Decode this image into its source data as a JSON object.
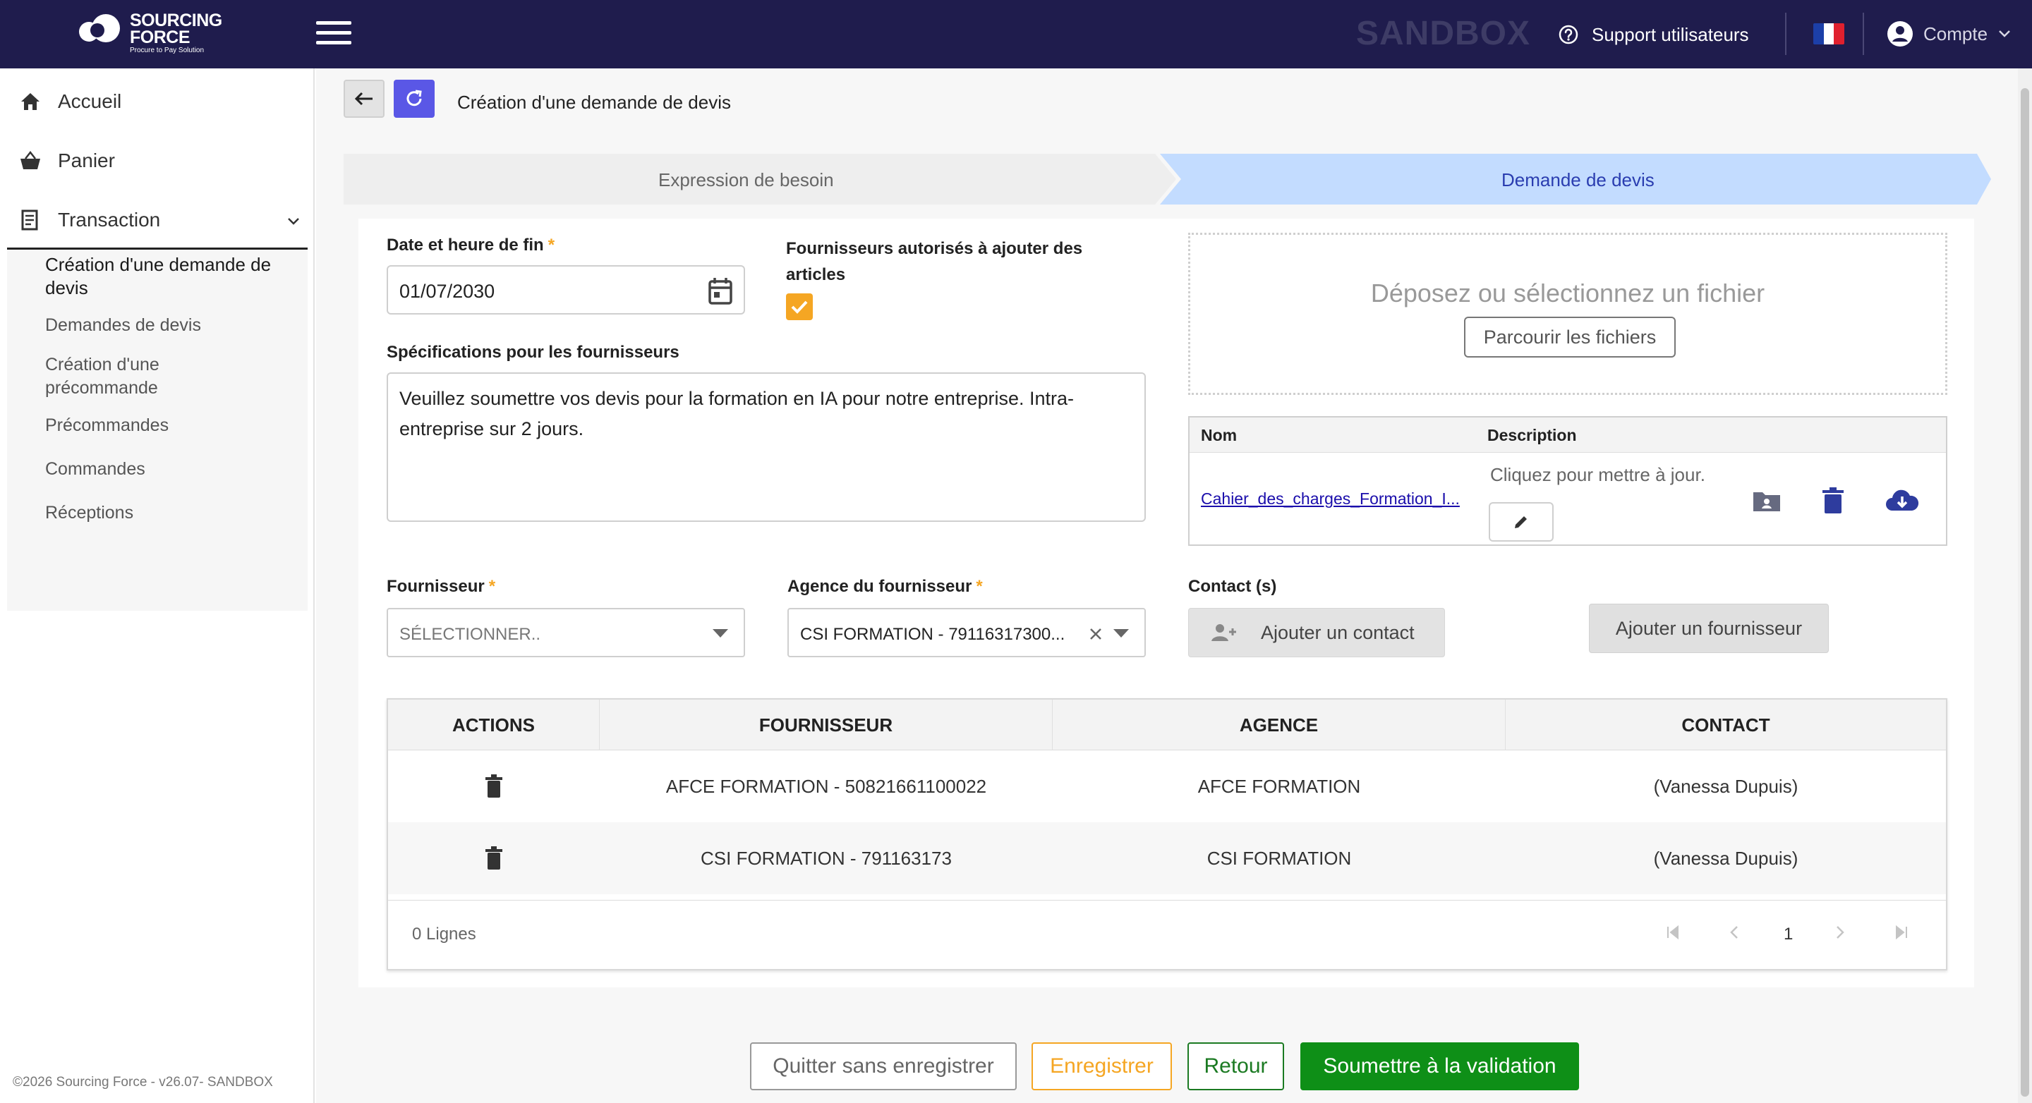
{
  "app": {
    "logo_line1": "SOURCING",
    "logo_line2": "FORCE",
    "logo_tagline": "Procure to Pay Solution",
    "environment": "SANDBOX",
    "support_label": "Support utilisateurs",
    "account_label": "Compte",
    "colors": {
      "topbar": "#1f1c4d",
      "accent_orange": "#f5a623",
      "primary_blue": "#5a57e6",
      "success_green": "#0e8f17"
    }
  },
  "sidebar": {
    "items": [
      {
        "label": "Accueil",
        "icon": "home-icon"
      },
      {
        "label": "Panier",
        "icon": "basket-icon"
      },
      {
        "label": "Transaction",
        "icon": "receipt-icon"
      }
    ],
    "sub_items": [
      {
        "label": "Création d'une demande de devis",
        "active": true
      },
      {
        "label": "Demandes de devis"
      },
      {
        "label": "Création d'une précommande"
      },
      {
        "label": "Précommandes"
      },
      {
        "label": "Commandes"
      },
      {
        "label": "Réceptions"
      }
    ],
    "footer": "©2026 Sourcing Force - v26.07- SANDBOX"
  },
  "page": {
    "title": "Création d'une demande de devis",
    "steps": [
      {
        "label": "Expression de besoin",
        "active": false
      },
      {
        "label": "Demande de devis",
        "active": true
      }
    ]
  },
  "form": {
    "end_date_label": "Date et heure de fin",
    "end_date_value": "01/07/2030",
    "suppliers_can_add_label": "Fournisseurs autorisés à ajouter des articles",
    "suppliers_can_add_checked": true,
    "specs_label": "Spécifications pour les fournisseurs",
    "specs_value": "Veuillez soumettre vos devis pour la formation en IA pour notre entreprise. Intra-entreprise sur 2 jours.",
    "dropzone_text": "Déposez ou sélectionnez un fichier",
    "browse_label": "Parcourir les fichiers",
    "files_headers": {
      "name": "Nom",
      "description": "Description"
    },
    "file": {
      "name": "Cahier_des_charges_Formation_I...",
      "description": "Cliquez pour mettre à jour."
    },
    "supplier_label": "Fournisseur",
    "supplier_placeholder": "SÉLECTIONNER..",
    "agency_label": "Agence du fournisseur",
    "agency_value": "CSI FORMATION - 79116317300...",
    "contact_label": "Contact (s)",
    "add_contact_label": "Ajouter un contact",
    "add_supplier_label": "Ajouter un fournisseur"
  },
  "grid": {
    "headers": [
      "ACTIONS",
      "FOURNISSEUR",
      "AGENCE",
      "CONTACT"
    ],
    "rows": [
      {
        "supplier": "AFCE FORMATION - 50821661100022",
        "agency": "AFCE FORMATION",
        "contact": "(Vanessa Dupuis)"
      },
      {
        "supplier": "CSI FORMATION - 791163173",
        "agency": "CSI FORMATION",
        "contact": "(Vanessa Dupuis)"
      }
    ],
    "row_count": "0 Lignes",
    "page": "1"
  },
  "actions": {
    "quit": "Quitter sans enregistrer",
    "save": "Enregistrer",
    "back": "Retour",
    "submit": "Soumettre à la validation"
  }
}
